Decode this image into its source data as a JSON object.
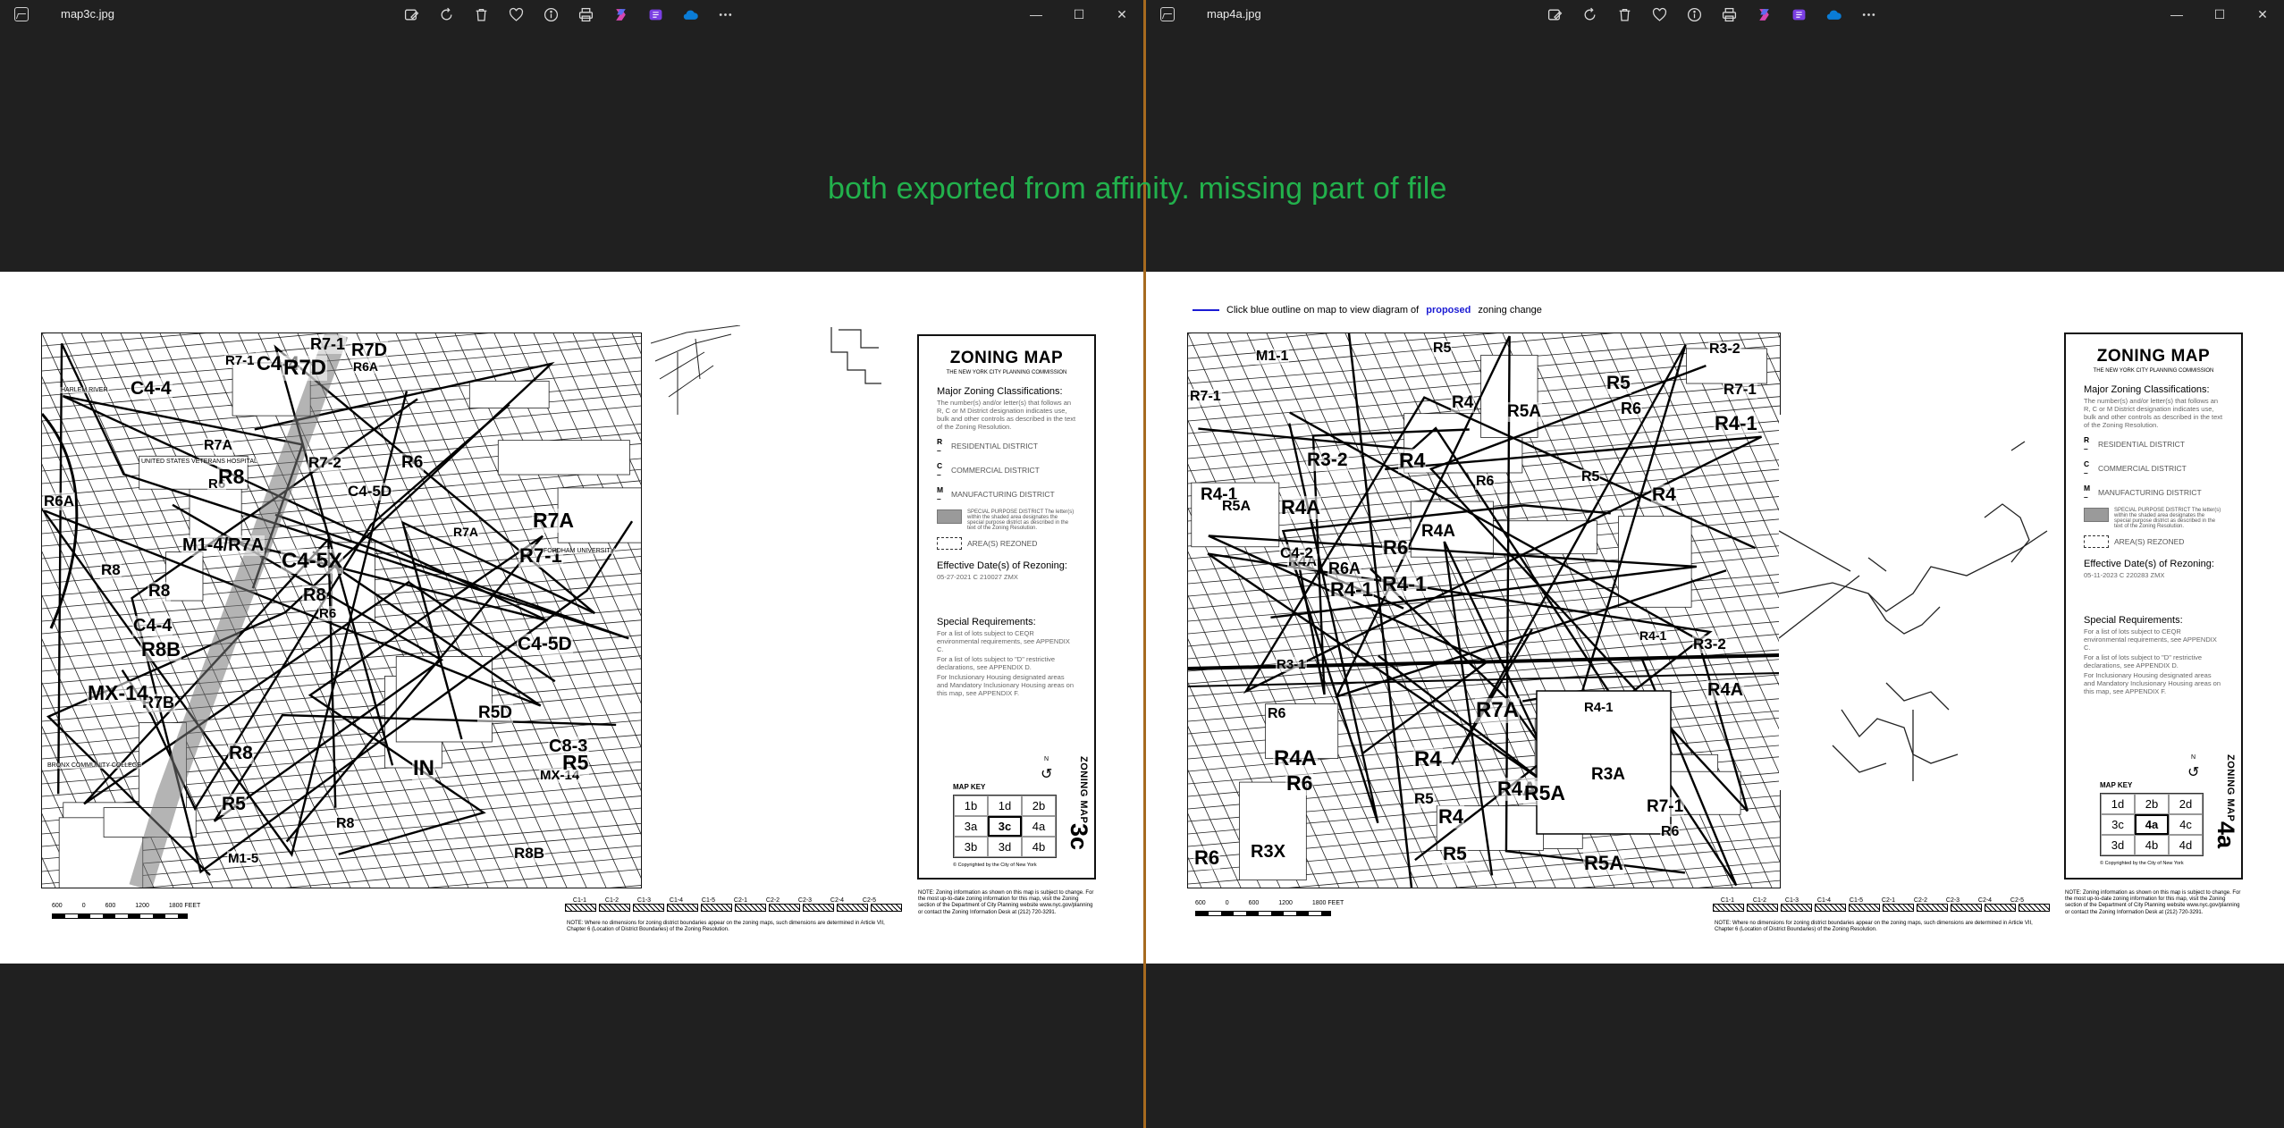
{
  "overlay_text": "both exported from affinity. missing part of file",
  "toolbar_icons": [
    "edit-image-icon",
    "rotate-icon",
    "delete-icon",
    "favorite-icon",
    "info-icon",
    "print-icon",
    "copilot-icon",
    "clipchamp-icon",
    "onedrive-icon",
    "more-icon"
  ],
  "window_controls": {
    "minimize": "—",
    "maximize": "☐",
    "close": "✕"
  },
  "left": {
    "filename": "map3c.jpg",
    "map_labels": [
      "M1-5",
      "IN",
      "R7-2",
      "R7B",
      "R8B",
      "R7A",
      "R7A",
      "C4-4",
      "R8",
      "R6",
      "C4-5D",
      "R6",
      "MX-14",
      "C4-5D",
      "R6",
      "R8",
      "R8",
      "R7-1",
      "R5",
      "R7-1",
      "C4-4",
      "R7A",
      "R6A",
      "C8-3",
      "R7-1",
      "R8",
      "R8",
      "C4-4",
      "R7D",
      "C4-5X",
      "R6A",
      "M1-4/R7A",
      "MX-14",
      "R5",
      "R5D",
      "R8B",
      "R7D",
      "R8"
    ],
    "map_text_small": [
      "HARLEM RIVER",
      "UNITED STATES VETERANS HOSPITAL",
      "FORDHAM UNIVERSITY",
      "BRONX COMMUNITY COLLEGE"
    ],
    "legend": {
      "title": "ZONING MAP",
      "subtitle": "THE NEW YORK CITY PLANNING COMMISSION",
      "major_heading": "Major Zoning Classifications:",
      "major_text": "The number(s) and/or letter(s) that follows an R, C or M District designation indicates use, bulk and other controls as described in the text of the Zoning Resolution.",
      "districts": [
        {
          "code": "R",
          "label": "RESIDENTIAL DISTRICT"
        },
        {
          "code": "C",
          "label": "COMMERCIAL DISTRICT"
        },
        {
          "code": "M",
          "label": "MANUFACTURING DISTRICT"
        }
      ],
      "special_purpose": "SPECIAL PURPOSE DISTRICT The letter(s) within the shaded area designates the special purpose district as described in the text of the Zoning Resolution.",
      "rezoned": "AREA(S) REZONED",
      "effective_heading": "Effective Date(s) of Rezoning:",
      "effective_value": "05-27-2021  C 210027 ZMX",
      "special_heading": "Special Requirements:",
      "special_items": [
        "For a list of lots subject to CEQR environmental requirements, see APPENDIX C.",
        "For a list of lots subject to \"D\" restrictive declarations, see APPENDIX D.",
        "For Inclusionary Housing designated areas and Mandatory Inclusionary Housing areas on this map, see APPENDIX F."
      ],
      "map_key_title": "MAP KEY",
      "map_key": [
        "1b",
        "1d",
        "2b",
        "3a",
        "3c",
        "4a",
        "3b",
        "3d",
        "4b"
      ],
      "map_key_current": "3c",
      "copyright": "© Copyrighted by the City of New York",
      "side_label": "ZONING MAP",
      "side_number": "3c",
      "north": "N"
    },
    "note": "NOTE: Zoning information as shown on this map is subject to change. For the most up-to-date zoning information for this map, visit the Zoning section of the Department of City Planning website www.nyc.gov/planning or contact the Zoning Information Desk at (212) 720-3291.",
    "dimension_note": "NOTE: Where no dimensions for zoning district boundaries appear on the zoning maps, such dimensions are determined in Article VII, Chapter 6 (Location of District Boundaries) of the Zoning Resolution.",
    "scale": [
      "600",
      "0",
      "600",
      "1200",
      "1800 FEET"
    ],
    "commercial_overlays": [
      "C1-1",
      "C1-2",
      "C1-3",
      "C1-4",
      "C1-5",
      "C2-1",
      "C2-2",
      "C2-3",
      "C2-4",
      "C2-5"
    ]
  },
  "right": {
    "filename": "map4a.jpg",
    "blue_note_pre": "Click blue outline on map to view diagram of",
    "blue_note_bold": "proposed",
    "blue_note_post": "zoning change",
    "map_labels": [
      "R5",
      "R5",
      "R6",
      "R7A",
      "R4-1",
      "R4",
      "R4-1",
      "R5A",
      "R4",
      "R4",
      "R6",
      "R5",
      "R4A",
      "R3-2",
      "R3-2",
      "R4-1",
      "R6",
      "R4A",
      "R4-1",
      "R3X",
      "R3-2",
      "R6",
      "R4A",
      "R4",
      "R6A",
      "R6",
      "R4A",
      "R7-1",
      "R4A",
      "R4-1",
      "R4A",
      "R3-1",
      "M1-1",
      "R5",
      "R5A",
      "R7-1",
      "R7-1",
      "R5A",
      "R5A",
      "R6",
      "R5",
      "C4-2",
      "R3A",
      "R6",
      "R4-1",
      "R4"
    ],
    "legend": {
      "title": "ZONING MAP",
      "subtitle": "THE NEW YORK CITY PLANNING COMMISSION",
      "major_heading": "Major Zoning Classifications:",
      "major_text": "The number(s) and/or letter(s) that follows an R, C or M District designation indicates use, bulk and other controls as described in the text of the Zoning Resolution.",
      "districts": [
        {
          "code": "R",
          "label": "RESIDENTIAL DISTRICT"
        },
        {
          "code": "C",
          "label": "COMMERCIAL DISTRICT"
        },
        {
          "code": "M",
          "label": "MANUFACTURING DISTRICT"
        }
      ],
      "special_purpose": "SPECIAL PURPOSE DISTRICT The letter(s) within the shaded area designates the special purpose district as described in the text of the Zoning Resolution.",
      "rezoned": "AREA(S) REZONED",
      "effective_heading": "Effective Date(s) of Rezoning:",
      "effective_value": "05-11-2023  C 220283 ZMX",
      "special_heading": "Special Requirements:",
      "special_items": [
        "For a list of lots subject to CEQR environmental requirements, see APPENDIX C.",
        "For a list of lots subject to \"D\" restrictive declarations, see APPENDIX D.",
        "For Inclusionary Housing designated areas and Mandatory Inclusionary Housing areas on this map, see APPENDIX F."
      ],
      "map_key_title": "MAP KEY",
      "map_key": [
        "1d",
        "2b",
        "2d",
        "3c",
        "4a",
        "4c",
        "3d",
        "4b",
        "4d"
      ],
      "map_key_current": "4a",
      "copyright": "© Copyrighted by the City of New York",
      "side_label": "ZONING MAP",
      "side_number": "4a",
      "north": "N"
    },
    "note": "NOTE: Zoning information as shown on this map is subject to change. For the most up-to-date zoning information for this map, visit the Zoning section of the Department of City Planning website www.nyc.gov/planning or contact the Zoning Information Desk at (212) 720-3291.",
    "dimension_note": "NOTE: Where no dimensions for zoning district boundaries appear on the zoning maps, such dimensions are determined in Article VII, Chapter 6 (Location of District Boundaries) of the Zoning Resolution.",
    "scale": [
      "600",
      "0",
      "600",
      "1200",
      "1800 FEET"
    ],
    "commercial_overlays": [
      "C1-1",
      "C1-2",
      "C1-3",
      "C1-4",
      "C1-5",
      "C2-1",
      "C2-2",
      "C2-3",
      "C2-4",
      "C2-5"
    ]
  }
}
